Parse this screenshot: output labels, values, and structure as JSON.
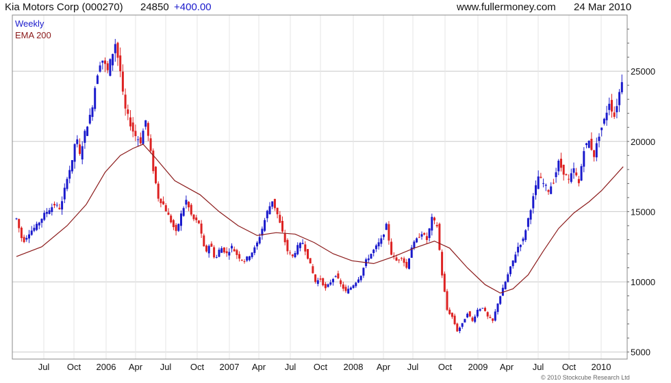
{
  "header": {
    "title": "Kia Motors Corp (000270)",
    "price": "24850",
    "change": "+400.00",
    "website": "www.fullermoney.com",
    "date": "24 Mar 2010"
  },
  "legend": {
    "weekly": "Weekly",
    "ema": "EMA 200"
  },
  "copyright": "© 2010 Stockcube Research Ltd",
  "colors": {
    "up": "#1a1acc",
    "down": "#dd2222",
    "ema": "#8b1a1a",
    "grid": "#c8c8c8"
  },
  "chart_data": {
    "type": "candlestick",
    "x_tick_labels": [
      "Jul",
      "Oct",
      "2006",
      "Apr",
      "Jul",
      "Oct",
      "2007",
      "Apr",
      "Jul",
      "Oct",
      "2008",
      "Apr",
      "Jul",
      "Oct",
      "2009",
      "Apr",
      "Jul",
      "Oct",
      "2010"
    ],
    "y_tick_labels": [
      "5000",
      "10000",
      "15000",
      "20000",
      "25000"
    ],
    "y_ticks": [
      5000,
      10000,
      15000,
      20000,
      25000
    ],
    "ylim": [
      4500,
      29000
    ],
    "grid": true,
    "legend_position": "top-left",
    "series": [
      {
        "name": "Weekly",
        "kind": "price",
        "points": [
          [
            0,
            14500
          ],
          [
            5,
            12800
          ],
          [
            10,
            13500
          ],
          [
            16,
            14000
          ],
          [
            22,
            14800
          ],
          [
            25,
            15100
          ],
          [
            30,
            15500
          ],
          [
            35,
            15200
          ],
          [
            40,
            17500
          ],
          [
            44,
            18500
          ],
          [
            47,
            20500
          ],
          [
            50,
            19000
          ],
          [
            55,
            21000
          ],
          [
            59,
            22000
          ],
          [
            63,
            24500
          ],
          [
            67,
            26000
          ],
          [
            72,
            25000
          ],
          [
            75,
            26000
          ],
          [
            78,
            27000
          ],
          [
            82,
            25000
          ],
          [
            85,
            22500
          ],
          [
            89,
            21500
          ],
          [
            93,
            20500
          ],
          [
            98,
            20000
          ],
          [
            102,
            21500
          ],
          [
            108,
            18000
          ],
          [
            112,
            16000
          ],
          [
            116,
            15500
          ],
          [
            121,
            14500
          ],
          [
            126,
            13500
          ],
          [
            130,
            14800
          ],
          [
            134,
            15800
          ],
          [
            139,
            14500
          ],
          [
            144,
            14200
          ],
          [
            149,
            12000
          ],
          [
            153,
            12800
          ],
          [
            157,
            11500
          ],
          [
            161,
            12500
          ],
          [
            166,
            12000
          ],
          [
            170,
            12500
          ],
          [
            175,
            11800
          ],
          [
            180,
            11500
          ],
          [
            185,
            12000
          ],
          [
            189,
            12500
          ],
          [
            193,
            13500
          ],
          [
            198,
            15000
          ],
          [
            202,
            15800
          ],
          [
            206,
            14800
          ],
          [
            210,
            13500
          ],
          [
            214,
            12200
          ],
          [
            218,
            11800
          ],
          [
            222,
            12500
          ],
          [
            226,
            12800
          ],
          [
            231,
            11500
          ],
          [
            236,
            10000
          ],
          [
            240,
            10200
          ],
          [
            244,
            9500
          ],
          [
            248,
            10000
          ],
          [
            252,
            10500
          ],
          [
            256,
            9800
          ],
          [
            260,
            9300
          ],
          [
            264,
            9600
          ],
          [
            268,
            10000
          ],
          [
            272,
            10500
          ],
          [
            276,
            11500
          ],
          [
            280,
            12000
          ],
          [
            284,
            12500
          ],
          [
            288,
            13000
          ],
          [
            292,
            14000
          ],
          [
            296,
            12000
          ],
          [
            300,
            11500
          ],
          [
            304,
            11800
          ],
          [
            308,
            11000
          ],
          [
            312,
            12500
          ],
          [
            316,
            13000
          ],
          [
            320,
            13500
          ],
          [
            324,
            13000
          ],
          [
            328,
            14500
          ],
          [
            332,
            14000
          ],
          [
            336,
            10500
          ],
          [
            340,
            8000
          ],
          [
            344,
            7500
          ],
          [
            348,
            6500
          ],
          [
            352,
            7000
          ],
          [
            356,
            7800
          ],
          [
            360,
            7200
          ],
          [
            364,
            8000
          ],
          [
            368,
            8200
          ],
          [
            372,
            7500
          ],
          [
            376,
            7200
          ],
          [
            380,
            8500
          ],
          [
            384,
            9500
          ],
          [
            388,
            10500
          ],
          [
            392,
            11500
          ],
          [
            396,
            12500
          ],
          [
            400,
            13000
          ],
          [
            404,
            14500
          ],
          [
            408,
            16000
          ],
          [
            412,
            17500
          ],
          [
            416,
            17000
          ],
          [
            420,
            16500
          ],
          [
            424,
            17200
          ],
          [
            428,
            18500
          ],
          [
            432,
            17800
          ],
          [
            436,
            17200
          ],
          [
            440,
            18000
          ],
          [
            444,
            17000
          ],
          [
            448,
            19500
          ],
          [
            452,
            20000
          ],
          [
            456,
            19000
          ],
          [
            460,
            20500
          ],
          [
            464,
            21500
          ],
          [
            468,
            22800
          ],
          [
            472,
            21800
          ],
          [
            476,
            23500
          ],
          [
            479,
            24850
          ]
        ]
      },
      {
        "name": "EMA 200",
        "kind": "ema",
        "points": [
          [
            0,
            11800
          ],
          [
            20,
            12500
          ],
          [
            40,
            14000
          ],
          [
            55,
            15500
          ],
          [
            70,
            17800
          ],
          [
            82,
            19000
          ],
          [
            92,
            19500
          ],
          [
            100,
            19800
          ],
          [
            110,
            18800
          ],
          [
            125,
            17200
          ],
          [
            145,
            16200
          ],
          [
            160,
            15000
          ],
          [
            175,
            14000
          ],
          [
            190,
            13300
          ],
          [
            205,
            13500
          ],
          [
            220,
            13400
          ],
          [
            235,
            12800
          ],
          [
            250,
            12000
          ],
          [
            265,
            11500
          ],
          [
            282,
            11300
          ],
          [
            298,
            11800
          ],
          [
            314,
            12400
          ],
          [
            330,
            12900
          ],
          [
            342,
            12400
          ],
          [
            356,
            11000
          ],
          [
            370,
            9800
          ],
          [
            382,
            9200
          ],
          [
            392,
            9500
          ],
          [
            404,
            10500
          ],
          [
            416,
            12200
          ],
          [
            428,
            13800
          ],
          [
            440,
            14900
          ],
          [
            452,
            15700
          ],
          [
            462,
            16500
          ],
          [
            472,
            17500
          ],
          [
            479,
            18200
          ]
        ]
      }
    ]
  }
}
